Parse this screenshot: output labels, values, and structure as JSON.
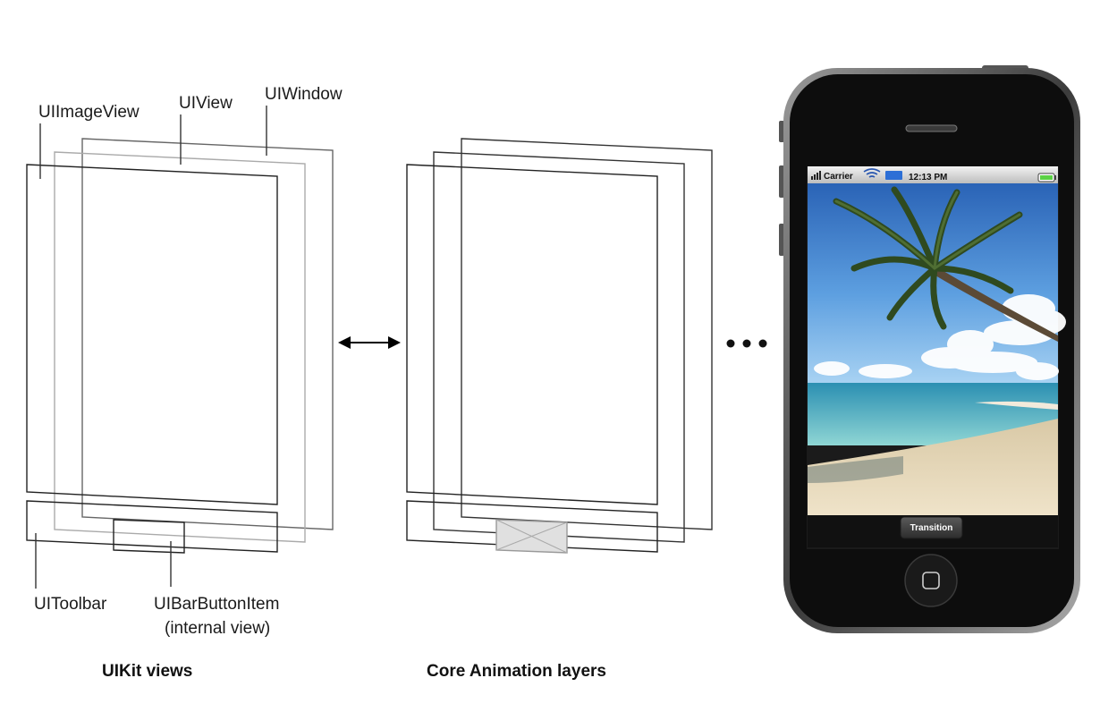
{
  "diagram": {
    "labels": {
      "imageview": "UIImageView",
      "view": "UIView",
      "window": "UIWindow",
      "toolbar": "UIToolbar",
      "barbutton_line1": "UIBarButtonItem",
      "barbutton_line2": "(internal view)"
    },
    "captions": {
      "uikit": "UIKit views",
      "coreanimation": "Core Animation layers"
    },
    "phone": {
      "status_carrier": "Carrier",
      "status_time": "12:13 PM",
      "button_label": "Transition"
    }
  },
  "colors": {
    "sky_top": "#2f6fc2",
    "sky_bottom": "#8fc1ea",
    "sea": "#3fa7b8",
    "sand": "#e6d8bc",
    "phone_body": "#111111"
  }
}
